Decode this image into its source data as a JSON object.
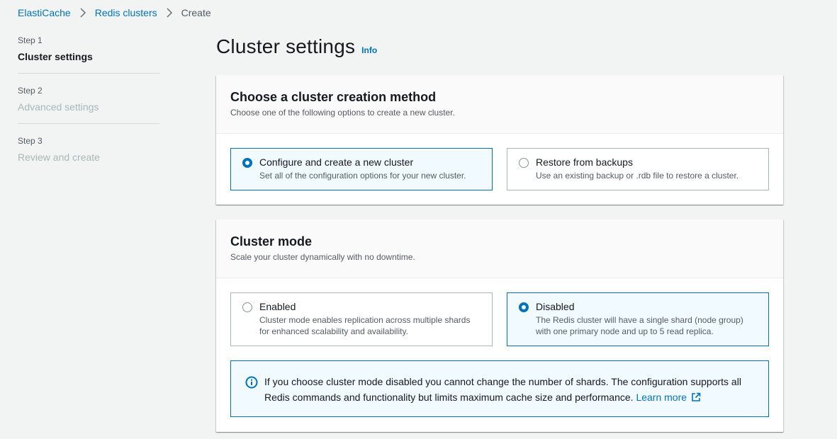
{
  "breadcrumb": {
    "items": [
      "ElastiCache",
      "Redis clusters"
    ],
    "current": "Create"
  },
  "steps": [
    {
      "number": "Step 1",
      "title": "Cluster settings",
      "state": "active"
    },
    {
      "number": "Step 2",
      "title": "Advanced settings",
      "state": "disabled"
    },
    {
      "number": "Step 3",
      "title": "Review and create",
      "state": "disabled"
    }
  ],
  "header": {
    "title": "Cluster settings",
    "info": "Info"
  },
  "creation_method": {
    "title": "Choose a cluster creation method",
    "description": "Choose one of the following options to create a new cluster.",
    "options": [
      {
        "label": "Configure and create a new cluster",
        "description": "Set all of the configuration options for your new cluster.",
        "selected": true
      },
      {
        "label": "Restore from backups",
        "description": "Use an existing backup or .rdb file to restore a cluster.",
        "selected": false
      }
    ]
  },
  "cluster_mode": {
    "title": "Cluster mode",
    "description": "Scale your cluster dynamically with no downtime.",
    "options": [
      {
        "label": "Enabled",
        "description_line1": "Cluster mode enables replication across multiple shards",
        "description_line2": "for enhanced scalability and availability.",
        "selected": false
      },
      {
        "label": "Disabled",
        "description_line1": "The Redis cluster will have a single shard (node group)",
        "description_line2": "with one primary node and up to 5 read replica.",
        "selected": true
      }
    ],
    "alert": {
      "line1": "If you choose cluster mode disabled you cannot change the number of shards. The configuration supports all",
      "line2": "Redis commands and functionality but limits maximum cache size and performance.",
      "link": "Learn more"
    }
  },
  "colors": {
    "accent": "#0073bb",
    "background": "#f2f3f3",
    "selected_tile": "#f1faff"
  },
  "icons": {
    "breadcrumb_separator": "chevron-right-icon",
    "alert": "info-circle-icon",
    "external_link": "external-link-icon"
  }
}
